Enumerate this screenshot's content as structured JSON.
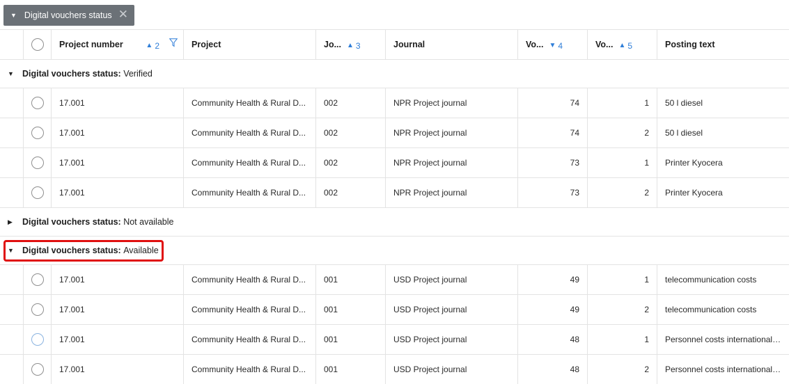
{
  "group_chip": {
    "label": "Digital vouchers status"
  },
  "header": {
    "project_number": "Project number",
    "project_number_sort": "2",
    "project": "Project",
    "journal_short": "Jo...",
    "journal_short_sort": "3",
    "journal": "Journal",
    "voucher_short_a": "Vo...",
    "voucher_short_a_sort": "4",
    "voucher_short_b": "Vo...",
    "voucher_short_b_sort": "5",
    "posting_text": "Posting text"
  },
  "groups": [
    {
      "key": "Digital vouchers status",
      "sep": ": ",
      "value": "Verified"
    },
    {
      "key": "Digital vouchers status",
      "sep": ": ",
      "value": "Not available"
    },
    {
      "key": "Digital vouchers status",
      "sep": ": ",
      "value": "Available"
    }
  ],
  "rows": [
    {
      "project_number": "17.001",
      "project": "Community Health & Rural D...",
      "jo": "002",
      "journal": "NPR Project journal",
      "vo1": "74",
      "vo2": "1",
      "posting_text": "50 l diesel"
    },
    {
      "project_number": "17.001",
      "project": "Community Health & Rural D...",
      "jo": "002",
      "journal": "NPR Project journal",
      "vo1": "74",
      "vo2": "2",
      "posting_text": "50 l diesel"
    },
    {
      "project_number": "17.001",
      "project": "Community Health & Rural D...",
      "jo": "002",
      "journal": "NPR Project journal",
      "vo1": "73",
      "vo2": "1",
      "posting_text": "Printer Kyocera"
    },
    {
      "project_number": "17.001",
      "project": "Community Health & Rural D...",
      "jo": "002",
      "journal": "NPR Project journal",
      "vo1": "73",
      "vo2": "2",
      "posting_text": "Printer Kyocera"
    },
    {
      "project_number": "17.001",
      "project": "Community Health & Rural D...",
      "jo": "001",
      "journal": "USD Project journal",
      "vo1": "49",
      "vo2": "1",
      "posting_text": "telecommunication costs"
    },
    {
      "project_number": "17.001",
      "project": "Community Health & Rural D...",
      "jo": "001",
      "journal": "USD Project journal",
      "vo1": "49",
      "vo2": "2",
      "posting_text": "telecommunication costs"
    },
    {
      "project_number": "17.001",
      "project": "Community Health & Rural D...",
      "jo": "001",
      "journal": "USD Project journal",
      "vo1": "48",
      "vo2": "1",
      "posting_text": "Personnel costs international ..."
    },
    {
      "project_number": "17.001",
      "project": "Community Health & Rural D...",
      "jo": "001",
      "journal": "USD Project journal",
      "vo1": "48",
      "vo2": "2",
      "posting_text": "Personnel costs international ..."
    }
  ]
}
